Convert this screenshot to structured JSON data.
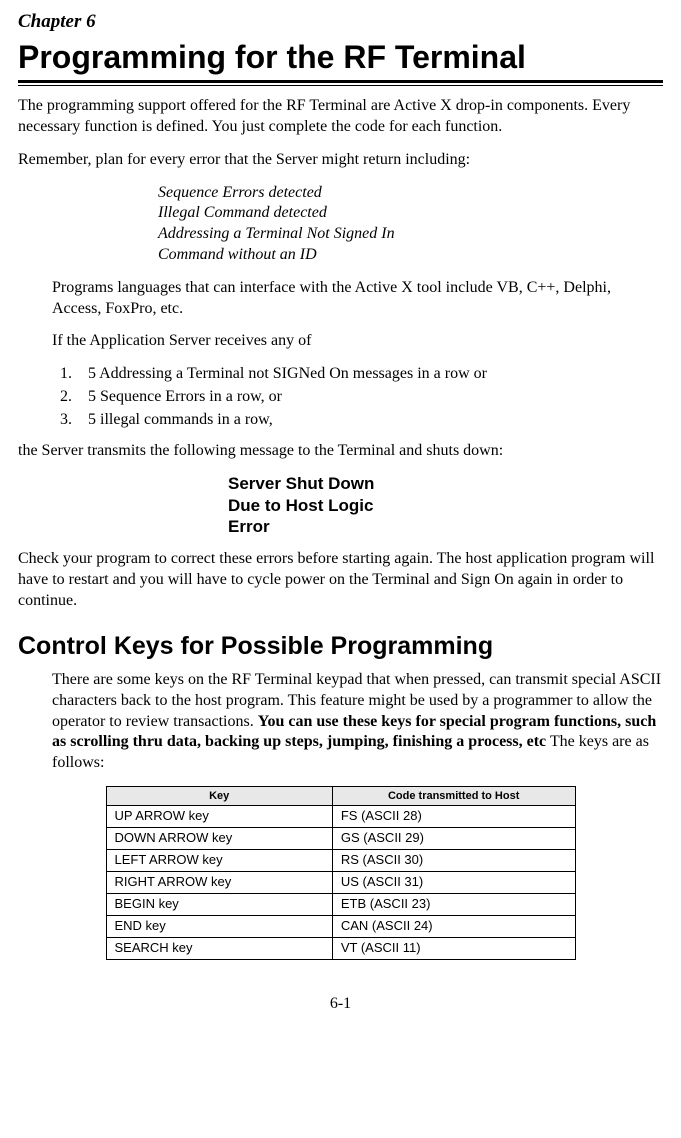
{
  "chapter_label": "Chapter 6",
  "title": "Programming for the RF Terminal",
  "intro1": "The programming support offered for the RF Terminal are Active X drop-in components. Every necessary function is defined. You just complete the code for each function.",
  "intro2": "Remember, plan for every error that the Server might return including:",
  "errors": {
    "e1": "Sequence Errors detected",
    "e2": "Illegal Command detected",
    "e3": "Addressing a Terminal Not Signed In",
    "e4": "Command without an ID"
  },
  "languages_para": "Programs languages that can interface with the Active X tool include VB, C++, Delphi, Access, FoxPro, etc.",
  "if_para": "If the Application Server receives any of",
  "list": {
    "i1": "5 Addressing a Terminal not SIGNed On messages in a row or",
    "i2": "5 Sequence Errors in a row, or",
    "i3": "5 illegal commands in a row,"
  },
  "transmit_para": " the Server transmits the following message to the Terminal and shuts down:",
  "server_msg": {
    "l1": "Server Shut Down",
    "l2": "Due to Host Logic",
    "l3": "Error"
  },
  "check_para": "Check your program to correct these errors before starting again. The host application program will have to restart and you will have to cycle power on the Terminal and Sign On again in order to continue.",
  "h2": "Control Keys for Possible Programming",
  "keys_para_start": "There are some keys on the RF Terminal keypad that when pressed, can transmit special ASCII characters back to the host program. This feature might be used by a programmer to allow the operator to review transactions. ",
  "keys_para_bold": "You can use these keys for special program functions, such as scrolling thru data, backing up steps, jumping, finishing a process, etc",
  "keys_para_end": " The keys are as follows:",
  "table": {
    "headers": {
      "h1": "Key",
      "h2": "Code transmitted to Host"
    },
    "rows": [
      {
        "key": "UP ARROW key",
        "code": "FS (ASCII 28)"
      },
      {
        "key": "DOWN ARROW key",
        "code": "GS (ASCII 29)"
      },
      {
        "key": "LEFT ARROW key",
        "code": "RS (ASCII 30)"
      },
      {
        "key": "RIGHT ARROW key",
        "code": "US (ASCII 31)"
      },
      {
        "key": "BEGIN key",
        "code": "ETB (ASCII 23)"
      },
      {
        "key": "END key",
        "code": "CAN (ASCII 24)"
      },
      {
        "key": "SEARCH key",
        "code": "VT (ASCII 11)"
      }
    ]
  },
  "page_num": "6-1"
}
